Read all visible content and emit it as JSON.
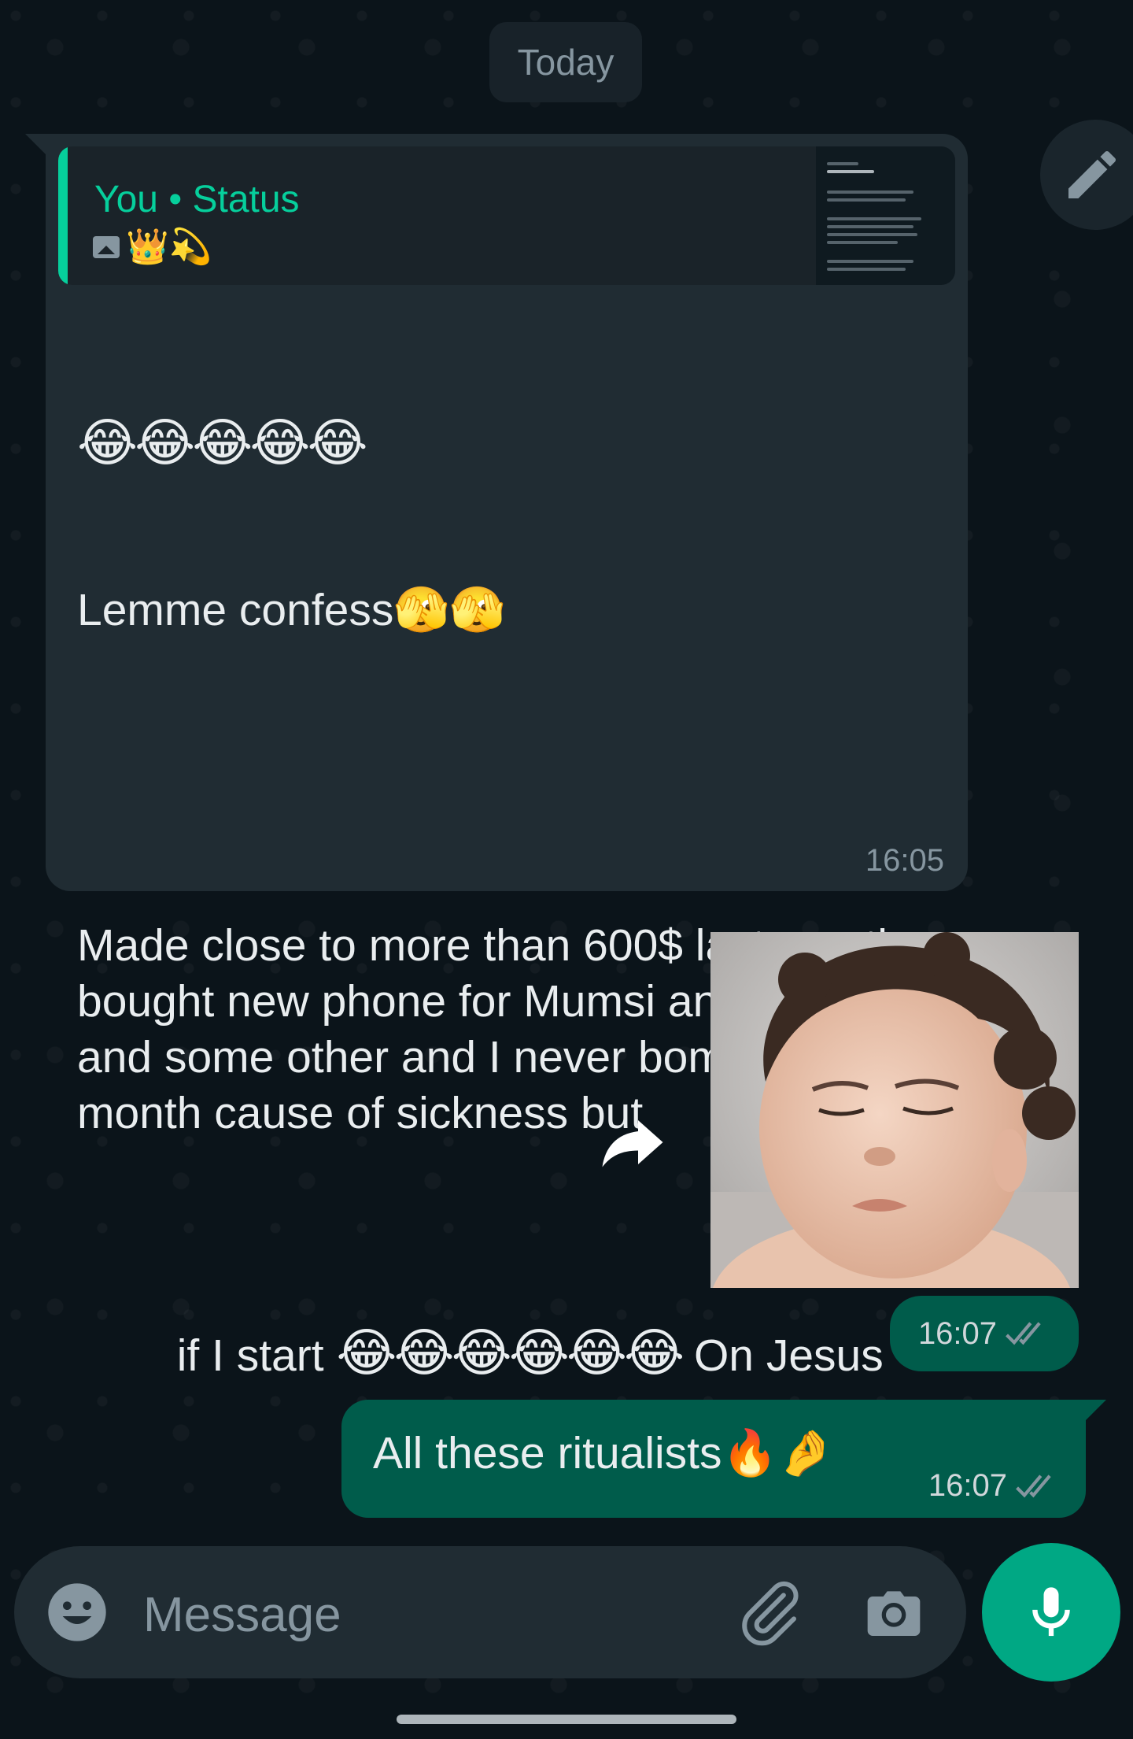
{
  "date_separator": "Today",
  "incoming": {
    "quote_title": "You • Status",
    "quote_emojis": "👑💫",
    "emoji_line": "😂😂😂😂😂",
    "line1": "Lemme confess🫣🫣",
    "paragraph": "Made close to more than 600$ last month bought new phone for Mumsi and my self and some other and I never bomb this month cause of sickness but",
    "last_line_start": "if I start ",
    "last_line_emojis": "😂😂😂😂😂😂",
    "last_line_end": " On Jesus",
    "time": "16:05"
  },
  "sticker": {
    "time": "16:07",
    "status": "read"
  },
  "outgoing": {
    "text": "All these ritualists🔥🤌",
    "time": "16:07",
    "status": "read"
  },
  "composer": {
    "placeholder": "Message"
  },
  "colors": {
    "background": "#0b141a",
    "incoming_bubble": "#202c33",
    "outgoing_bubble": "#005c4b",
    "accent": "#00a884",
    "quote_accent": "#06cf9c",
    "read_ticks": "#8696a0"
  },
  "icons": [
    "pencil-icon",
    "image-icon",
    "forward-icon",
    "double-check-icon",
    "emoji-icon",
    "attach-icon",
    "camera-icon",
    "mic-icon"
  ]
}
